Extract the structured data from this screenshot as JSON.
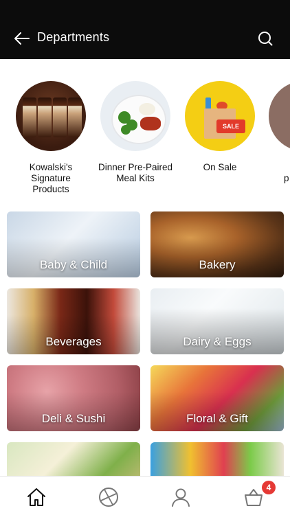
{
  "header": {
    "title": "Departments",
    "back_icon": "arrow-left-icon",
    "search_icon": "search-icon"
  },
  "featured": [
    {
      "label": "Kowalski's Signature Products"
    },
    {
      "label": "Dinner Pre-Paired Meal Kits"
    },
    {
      "label": "On Sale",
      "tag": "SALE"
    },
    {
      "label": "p"
    }
  ],
  "departments": [
    {
      "label": "Baby & Child"
    },
    {
      "label": "Bakery"
    },
    {
      "label": "Beverages"
    },
    {
      "label": "Dairy & Eggs"
    },
    {
      "label": "Deli & Sushi"
    },
    {
      "label": "Floral & Gift"
    },
    {
      "label": ""
    },
    {
      "label": ""
    }
  ],
  "bottom_nav": {
    "items": [
      "home-icon",
      "aperture-icon",
      "user-icon",
      "basket-icon"
    ],
    "cart_count": "4"
  },
  "colors": {
    "header_bg": "#0c0c0c",
    "badge": "#e53935",
    "sale_yellow": "#f4ce14"
  }
}
